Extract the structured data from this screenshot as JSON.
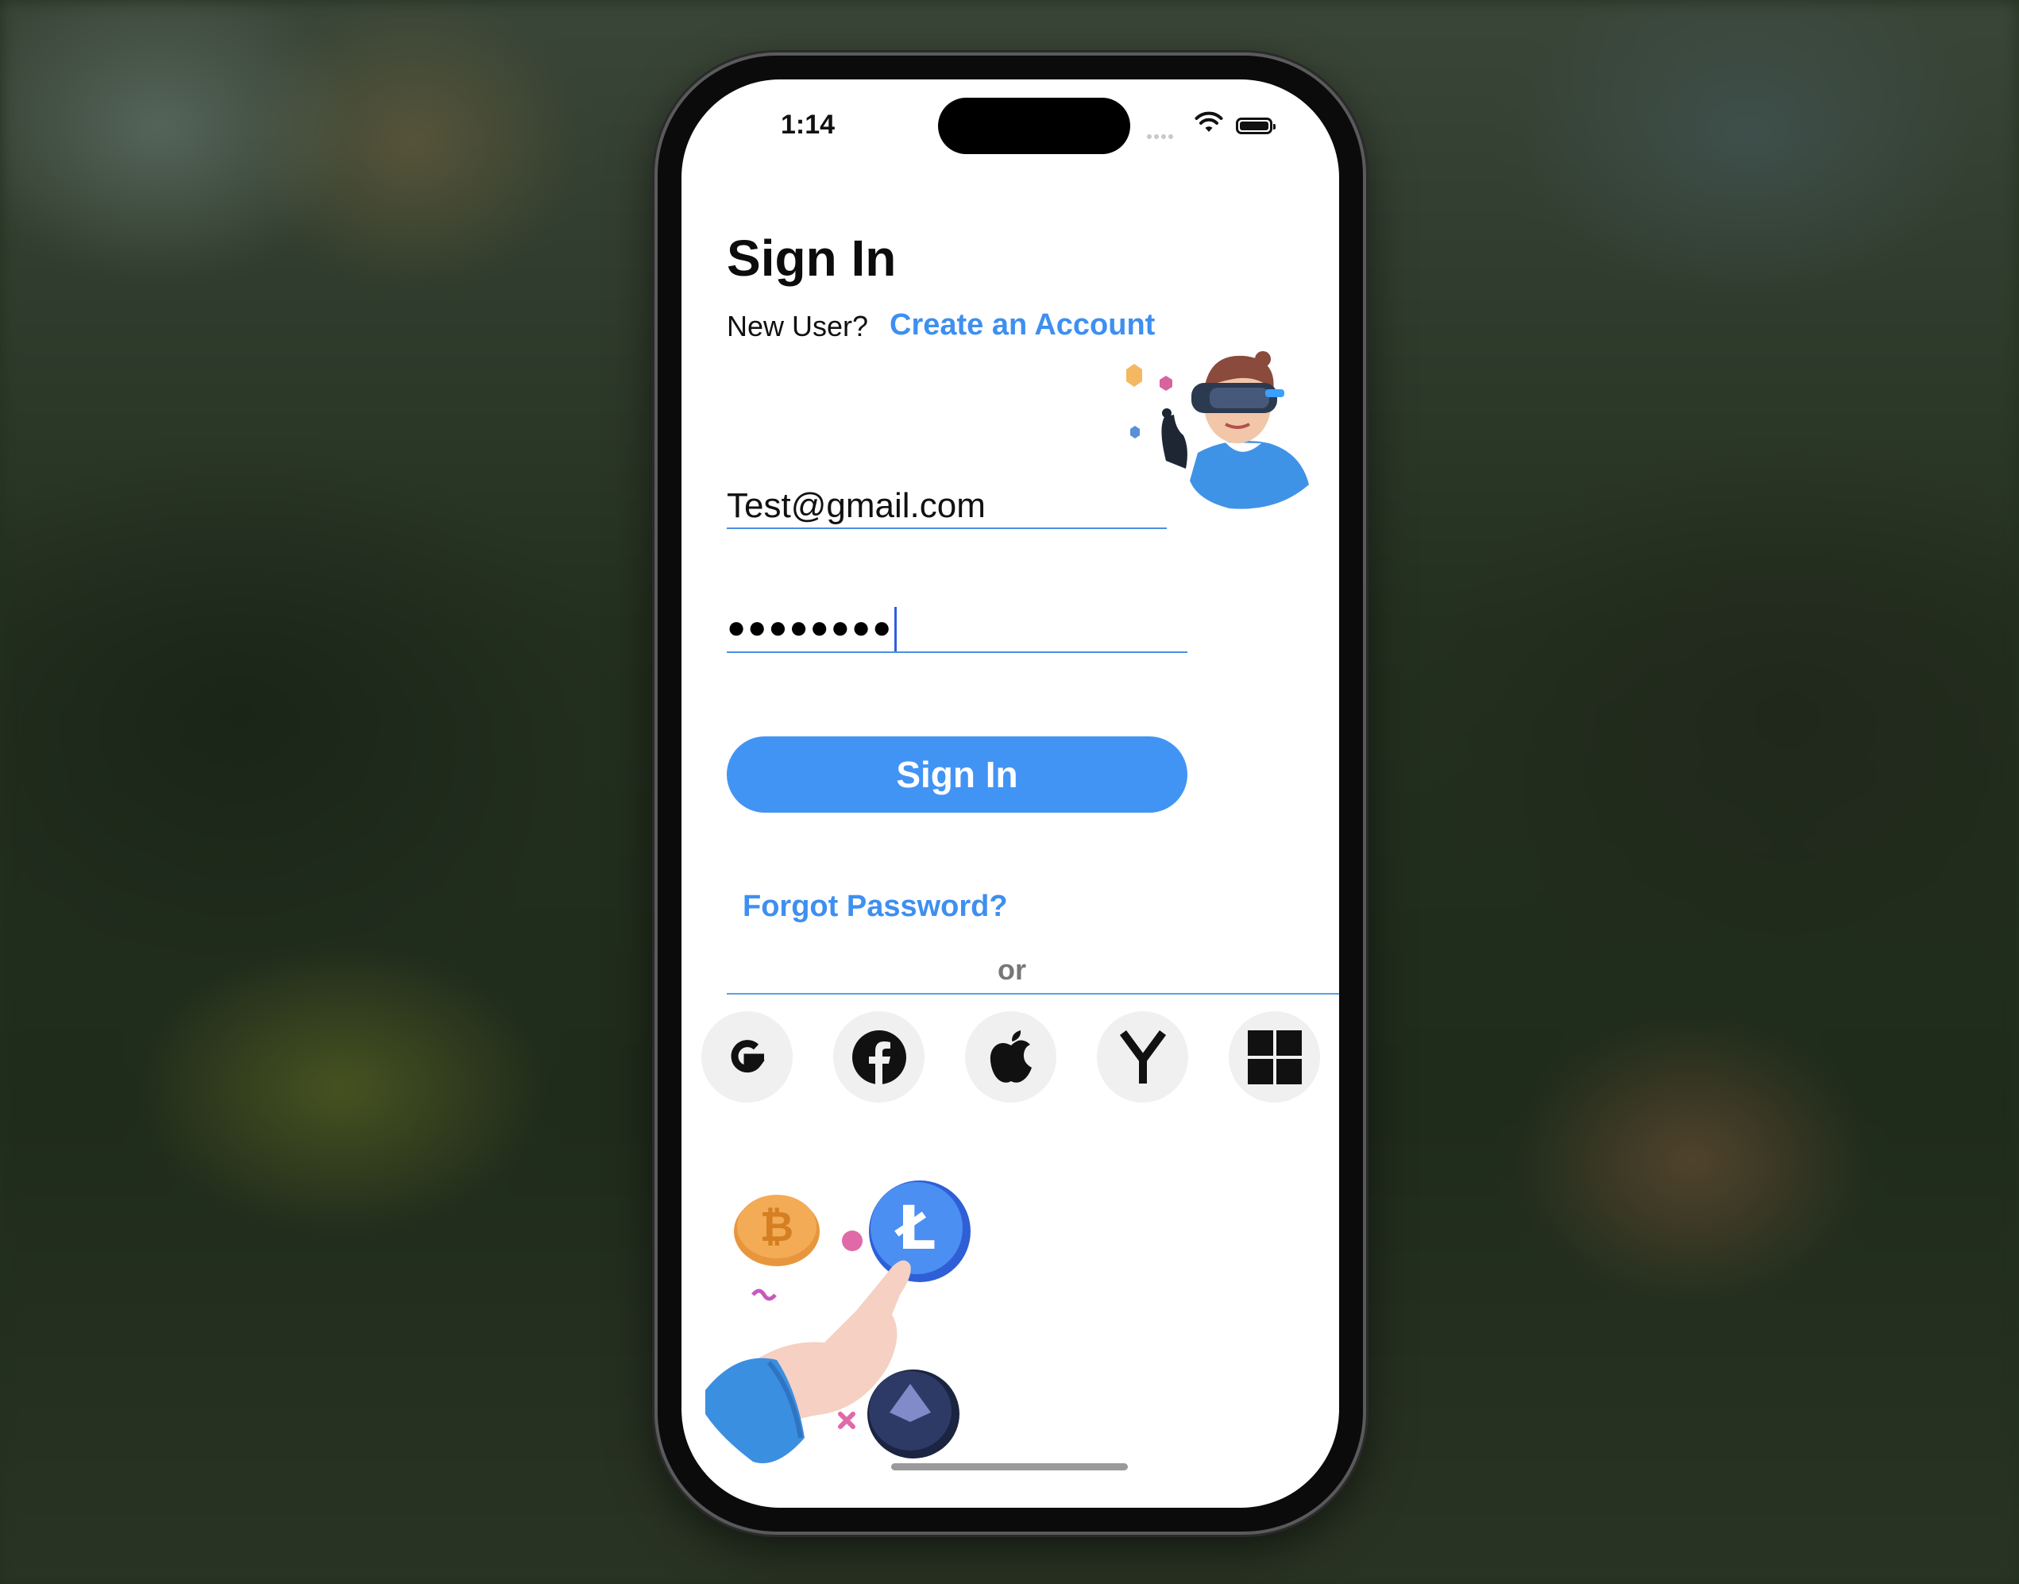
{
  "status_bar": {
    "time": "1:14"
  },
  "signin": {
    "title": "Sign In",
    "new_user_label": "New User?",
    "create_account_link": "Create an Account",
    "email_value": "Test@gmail.com",
    "password_masked": "●●●●●●●●",
    "button_label": "Sign In",
    "forgot_password_link": "Forgot Password?",
    "divider_label": "or"
  },
  "social_providers": [
    {
      "name": "Google",
      "icon": "google-icon",
      "glyph": "G"
    },
    {
      "name": "Facebook",
      "icon": "facebook-icon"
    },
    {
      "name": "Apple",
      "icon": "apple-icon"
    },
    {
      "name": "Yahoo",
      "icon": "yahoo-icon",
      "glyph": "Y"
    },
    {
      "name": "Microsoft",
      "icon": "microsoft-icon"
    }
  ],
  "colors": {
    "accent": "#3e8ff0",
    "button": "#4294f4",
    "social_bg": "#f0f0f0"
  }
}
